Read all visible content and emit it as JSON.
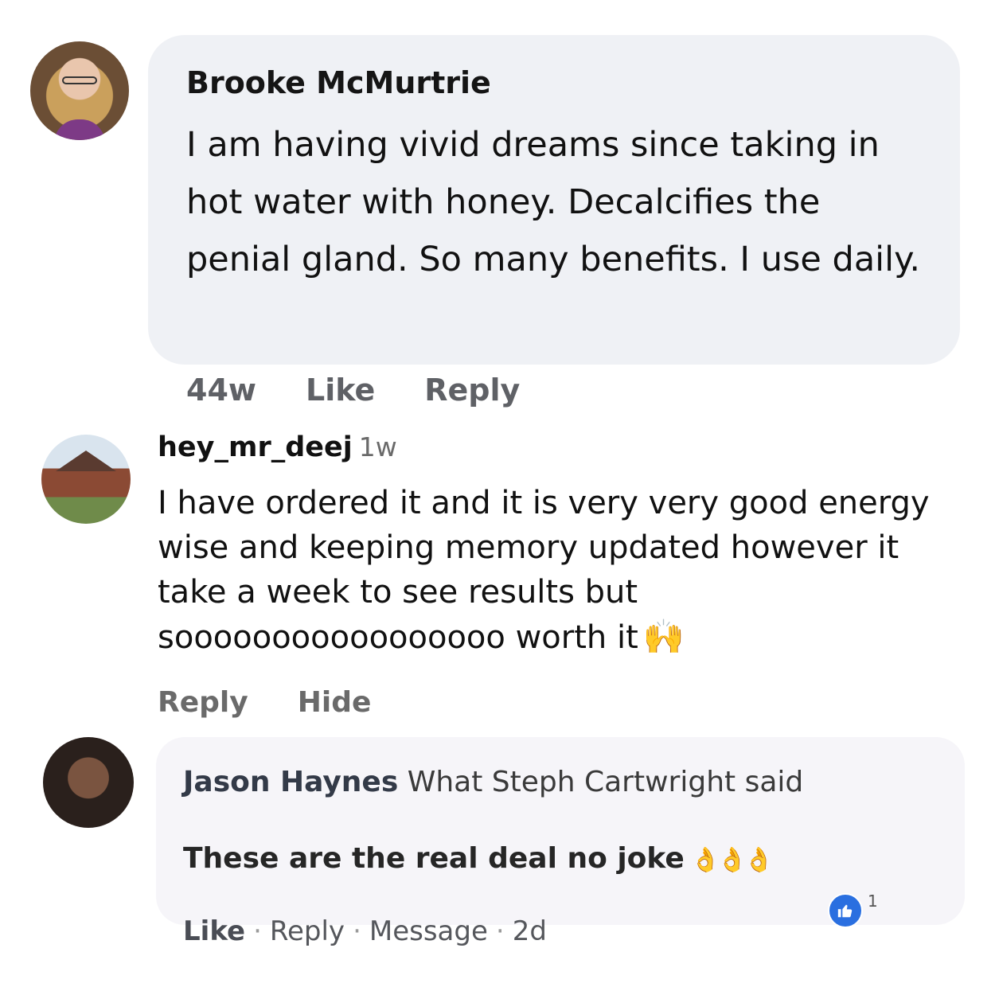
{
  "comments": [
    {
      "author": "Brooke McMurtrie",
      "text": "I am having vivid dreams since taking in hot water with honey. Decalcifies the penial gland. So many benefits. I use daily.",
      "timestamp": "44w",
      "actions": [
        "Like",
        "Reply"
      ]
    },
    {
      "author": "hey_mr_deej",
      "timestamp": "1w",
      "text": "I have ordered it and it is very very good energy wise and keeping memory updated however it take a week to see results but sooooooooooooooooo worth it",
      "emoji": "🙌",
      "actions": [
        "Reply",
        "Hide"
      ]
    },
    {
      "author": "Jason Haynes",
      "header_text": "What Steph Cartwright said",
      "text": "These are the real deal no joke",
      "emoji": "👌👌👌",
      "actions": [
        "Like",
        "Reply",
        "Message"
      ],
      "timestamp": "2d",
      "reaction_count": "1",
      "reaction_icon": "thumbs-up-icon"
    }
  ],
  "colors": {
    "bubble_fb": "#eff1f5",
    "action_gray": "#5f6166",
    "like_blue": "#2a6fe0"
  }
}
